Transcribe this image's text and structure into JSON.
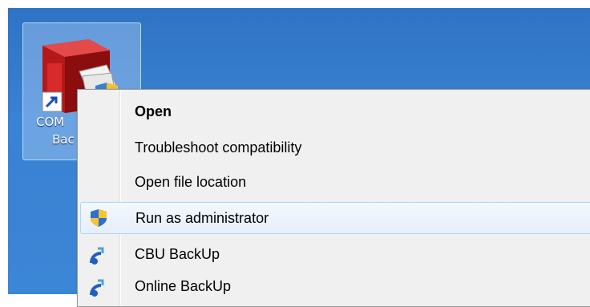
{
  "desktop": {
    "shortcut_label_line1": "COM",
    "shortcut_label_line2": "Bac"
  },
  "context_menu": {
    "items": [
      {
        "label": "Open",
        "bold": true
      },
      {
        "label": "Troubleshoot compatibility"
      },
      {
        "label": "Open file location"
      },
      {
        "label": "Run as administrator",
        "icon": "uac-shield-icon",
        "highlighted": true
      },
      {
        "label": "CBU BackUp",
        "icon": "backup-app-icon"
      },
      {
        "label": "Online BackUp",
        "icon": "backup-app-icon"
      }
    ]
  },
  "colors": {
    "desktop_background": "#3a82d3",
    "menu_background": "#f0f0f0",
    "highlight_border": "#a8d8f7"
  }
}
